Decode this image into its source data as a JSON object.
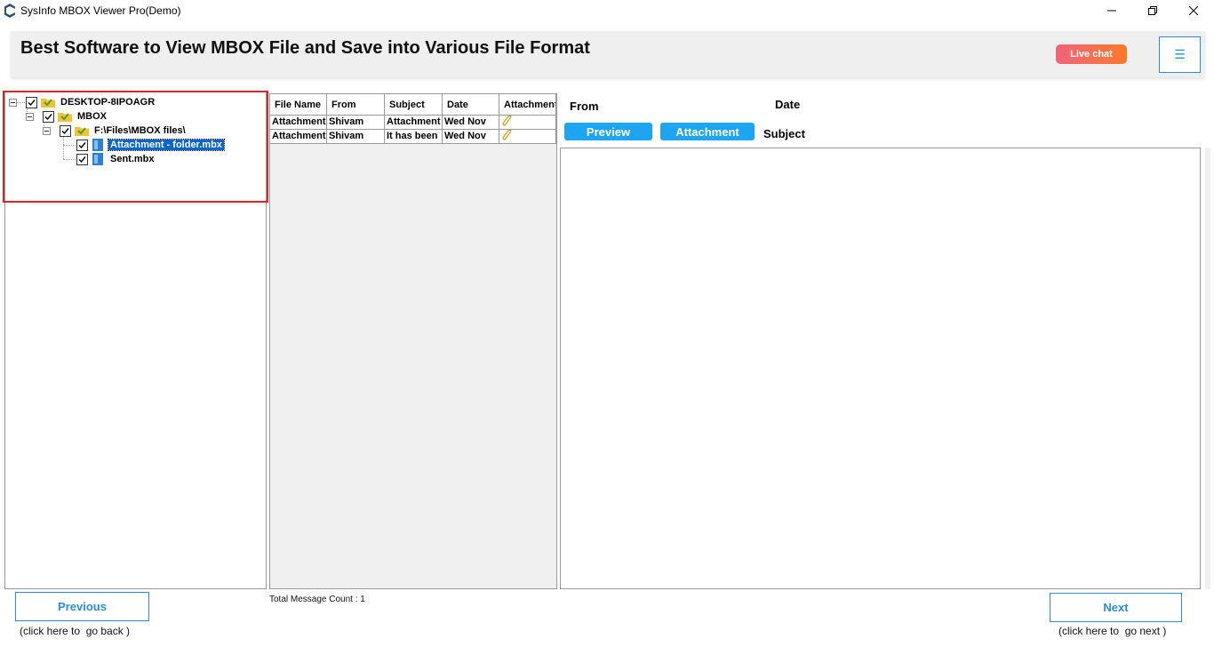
{
  "window": {
    "title": "SysInfo MBOX Viewer Pro(Demo)",
    "controls": [
      "minimize-icon",
      "restore-icon",
      "close-icon"
    ]
  },
  "header": {
    "title": "Best Software to View MBOX File and Save into Various File Format",
    "live_chat": "Live chat",
    "menu_icon": "hamburger-icon"
  },
  "tree": {
    "nodes": [
      {
        "label": "DESKTOP-8IPOAGR",
        "checked": true,
        "icon": "folder-icon",
        "expanded": true
      },
      {
        "label": "MBOX",
        "checked": true,
        "icon": "folder-icon",
        "expanded": true
      },
      {
        "label": "F:\\Files\\MBOX files\\",
        "checked": true,
        "icon": "folder-icon",
        "expanded": true
      },
      {
        "label": "Attachment - folder.mbx",
        "checked": true,
        "icon": "mbox-file-icon",
        "selected": true
      },
      {
        "label": "Sent.mbx",
        "checked": true,
        "icon": "mbox-file-icon"
      }
    ]
  },
  "message_list": {
    "columns": [
      "File Name",
      "From",
      "Subject",
      "Date",
      "Attachment"
    ],
    "rows": [
      {
        "file_name": "Attachment",
        "from": "Shivam",
        "subject": "Attachment",
        "date": "Wed Nov",
        "attachment_icon": "paperclip-icon"
      },
      {
        "file_name": "Attachment",
        "from": "Shivam",
        "subject": "It has been",
        "date": "Wed Nov",
        "attachment_icon": "paperclip-icon"
      }
    ],
    "total_count": "Total Message Count : 1"
  },
  "preview": {
    "from_label": "From",
    "date_label": "Date",
    "subject_label": "Subject",
    "preview_button": "Preview",
    "attachment_button": "Attachment"
  },
  "footer": {
    "previous_label": "Previous",
    "previous_hint": "(click here to  go back )",
    "next_label": "Next",
    "next_hint": "(click here to  go next )"
  },
  "colors": {
    "accent": "#1ea5f2",
    "border_blue": "#2a8dd6",
    "highlight_red": "#d9252a",
    "selection": "#0a66c9",
    "live_chat_start": "#f0637a",
    "live_chat_end": "#f97a2a"
  }
}
